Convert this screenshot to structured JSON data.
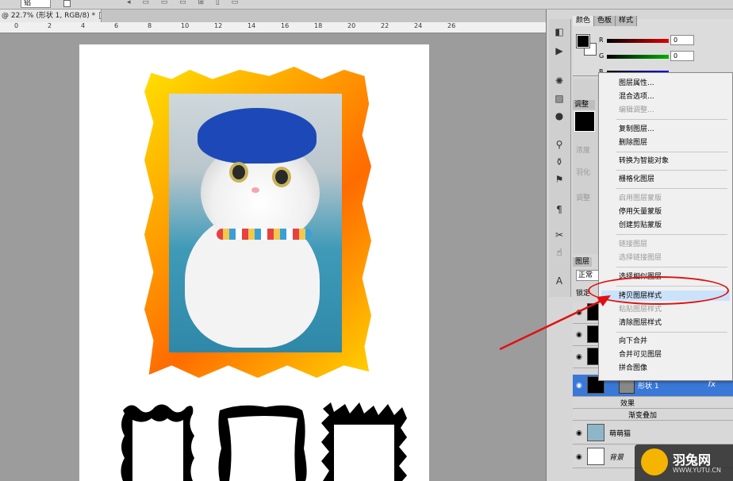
{
  "options_bar": {
    "select_value": "铝",
    "dots": "◂  ▭  ▭  ▭  ⊞  ▯  ▭"
  },
  "document_tab": {
    "title": "@ 22.7% (形状 1, RGB/8) *",
    "close": "✕"
  },
  "ruler": {
    "labels": [
      "0",
      "2",
      "4",
      "6",
      "8",
      "10",
      "12",
      "14",
      "16",
      "18",
      "20",
      "22",
      "24",
      "26"
    ]
  },
  "color_panel": {
    "tabs": [
      "颜色",
      "色板",
      "样式"
    ],
    "channels": [
      {
        "label": "R",
        "value": "0",
        "color": "#e00000"
      },
      {
        "label": "G",
        "value": "0",
        "color": "#00b000"
      },
      {
        "label": "B",
        "value": "0",
        "color": "#0000e0"
      }
    ]
  },
  "adjust_panel": {
    "tab": "调整",
    "labels": [
      "浓度",
      "羽化",
      "调整"
    ]
  },
  "layers_panel": {
    "tab": "图层",
    "blend_mode": "正常",
    "lock_label": "锁定",
    "shape_layer": "形状 1",
    "fx": "fx",
    "effects_label": "效果",
    "gradient_overlay": "渐变叠加",
    "cat_layer": "萌萌猫",
    "background_layer": "背景"
  },
  "context_menu": {
    "items": [
      {
        "label": "图层属性...",
        "disabled": false
      },
      {
        "label": "混合选项...",
        "disabled": false
      },
      {
        "label": "编辑调整...",
        "disabled": true
      },
      {
        "label": "复制图层...",
        "disabled": false
      },
      {
        "label": "删除图层",
        "disabled": false
      },
      {
        "label": "转换为智能对象",
        "disabled": false
      },
      {
        "label": "栅格化图层",
        "disabled": false
      },
      {
        "label": "启用图层蒙版",
        "disabled": true
      },
      {
        "label": "停用矢量蒙版",
        "disabled": false
      },
      {
        "label": "创建剪贴蒙版",
        "disabled": false
      },
      {
        "label": "链接图层",
        "disabled": true
      },
      {
        "label": "选择链接图层",
        "disabled": true
      },
      {
        "label": "选择相似图层",
        "disabled": false
      },
      {
        "label": "拷贝图层样式",
        "disabled": false
      },
      {
        "label": "粘贴图层样式",
        "disabled": true
      },
      {
        "label": "清除图层样式",
        "disabled": false
      },
      {
        "label": "向下合并",
        "disabled": false
      },
      {
        "label": "合并可见图层",
        "disabled": false
      },
      {
        "label": "拼合图像",
        "disabled": false
      }
    ]
  },
  "colors": {
    "annotation_red": "#e01010",
    "frame_yellow": "#ffe100",
    "frame_orange": "#ff6b00",
    "selected_layer": "#3a78d8"
  },
  "watermark": {
    "title": "羽兔网",
    "url": "WWW.YUTU.CN"
  }
}
